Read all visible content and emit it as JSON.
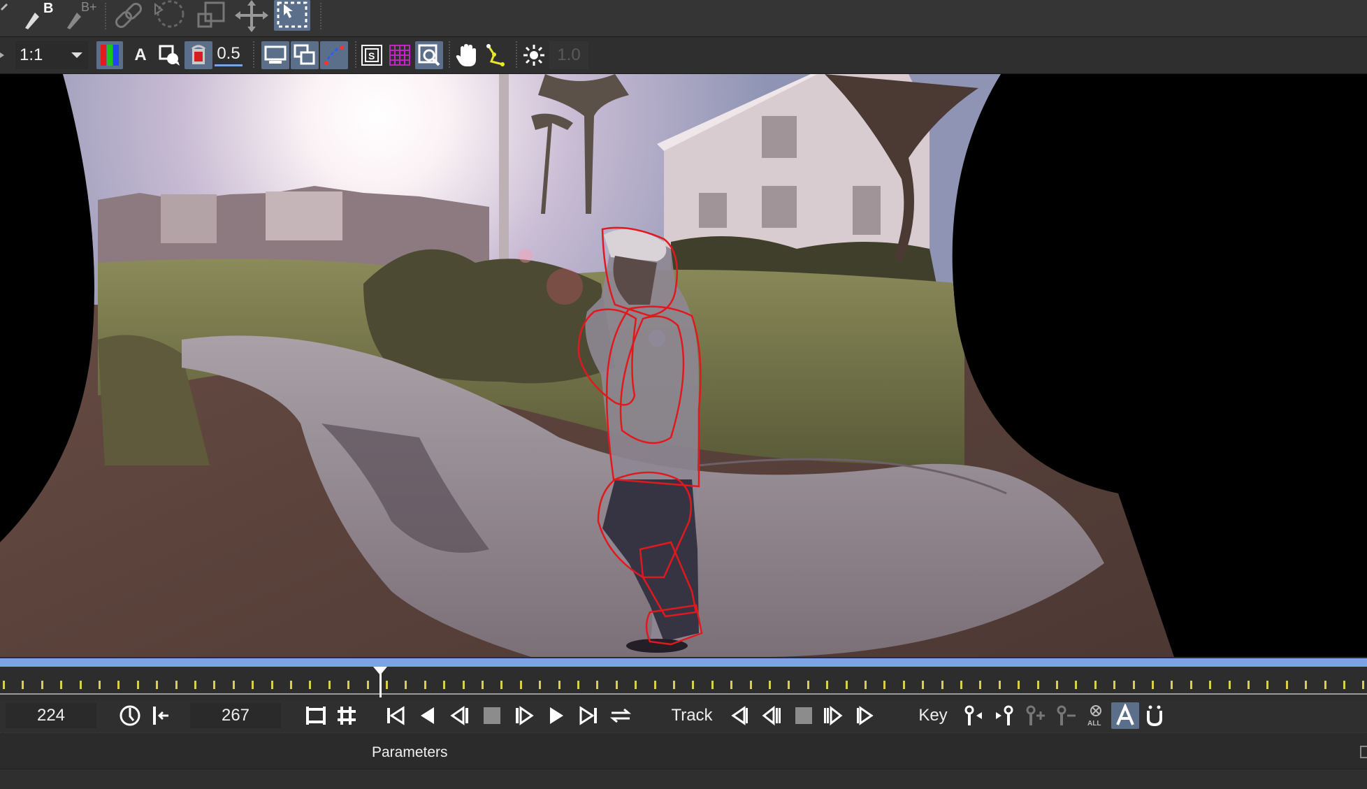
{
  "toolbar_view": {
    "zoom_value": "1:1",
    "alpha_label": "A",
    "opacity_value": "0.5",
    "exposure_value": "1.0"
  },
  "transport": {
    "in_frame": "224",
    "out_frame": "267",
    "track_label": "Track",
    "key_label": "Key"
  },
  "parameters": {
    "label": "Parameters"
  },
  "timeline": {
    "playhead_frame": 224
  },
  "colors": {
    "accent": "#7ba3e6",
    "spline": "#e0191e",
    "tick": "#d8cf4a",
    "selected_button": "#5c6f8a"
  }
}
